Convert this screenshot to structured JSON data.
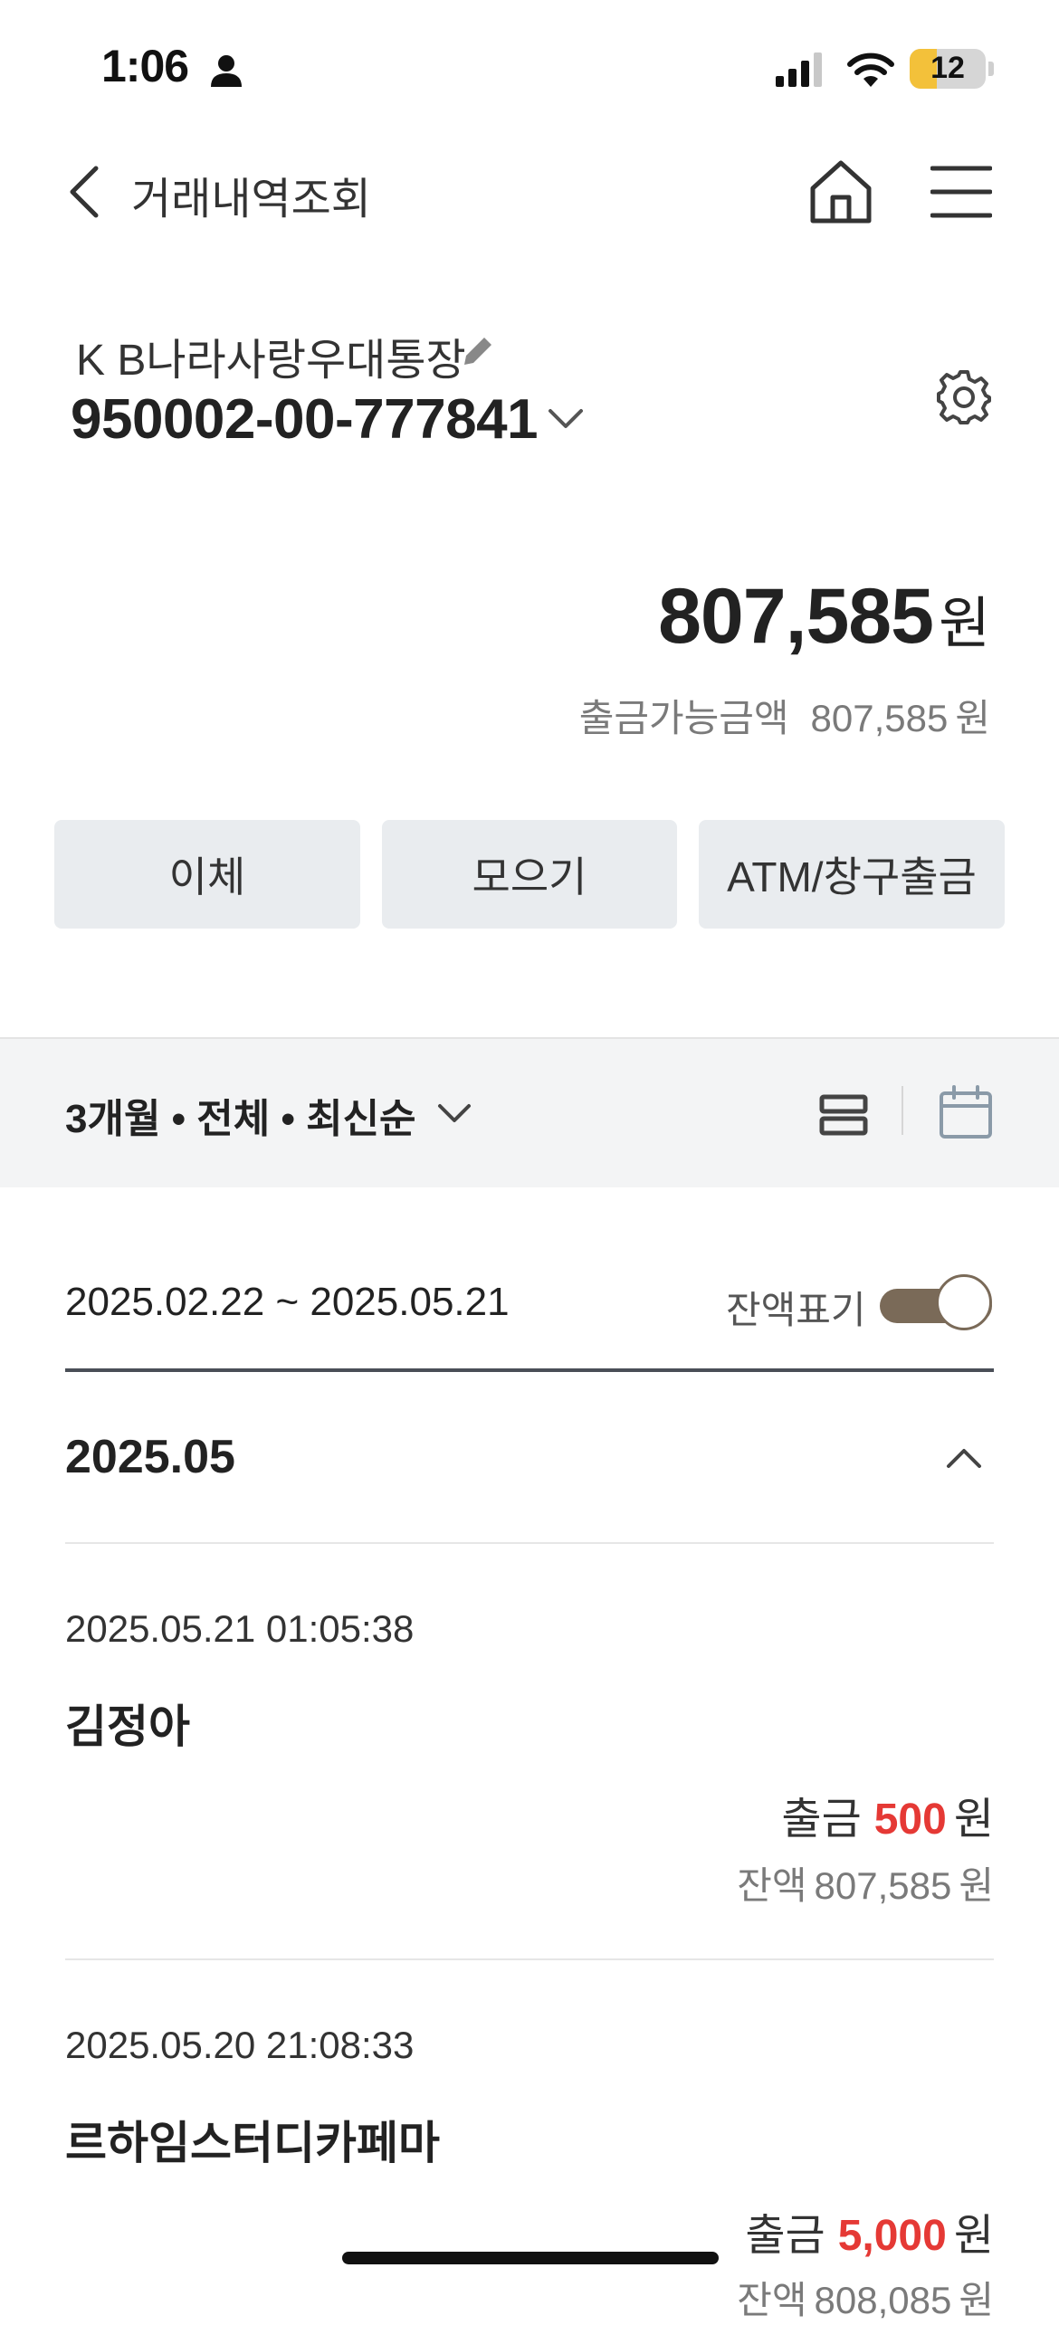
{
  "status_bar": {
    "time": "1:06",
    "battery": "12"
  },
  "header": {
    "title": "거래내역조회"
  },
  "account": {
    "name": "K B나라사랑우대통장",
    "number": "950002-00-777841"
  },
  "balance": {
    "amount": "807,585",
    "unit": "원",
    "available_label": "출금가능금액",
    "available_amount": "807,585",
    "available_unit": "원"
  },
  "actions": {
    "transfer": "이체",
    "collect": "모으기",
    "atm": "ATM/창구출금"
  },
  "filter": {
    "label": "3개월 • 전체 • 최신순"
  },
  "period": {
    "range": "2025.02.22 ~ 2025.05.21",
    "balance_toggle_label": "잔액표기",
    "balance_toggle_on": true
  },
  "month": {
    "label": "2025.05"
  },
  "transactions": [
    {
      "datetime": "2025.05.21 01:05:38",
      "name": "김정아",
      "type": "출금",
      "amount": "500",
      "unit": "원",
      "balance_label": "잔액",
      "balance": "807,585",
      "balance_unit": "원"
    },
    {
      "datetime": "2025.05.20 21:08:33",
      "name": "르하임스터디카페마",
      "type": "출금",
      "amount": "5,000",
      "unit": "원",
      "balance_label": "잔액",
      "balance": "808,085",
      "balance_unit": "원"
    }
  ],
  "colors": {
    "withdrawal": "#e53935",
    "toggle": "#7a6a58",
    "button_bg": "#e9ecef"
  }
}
